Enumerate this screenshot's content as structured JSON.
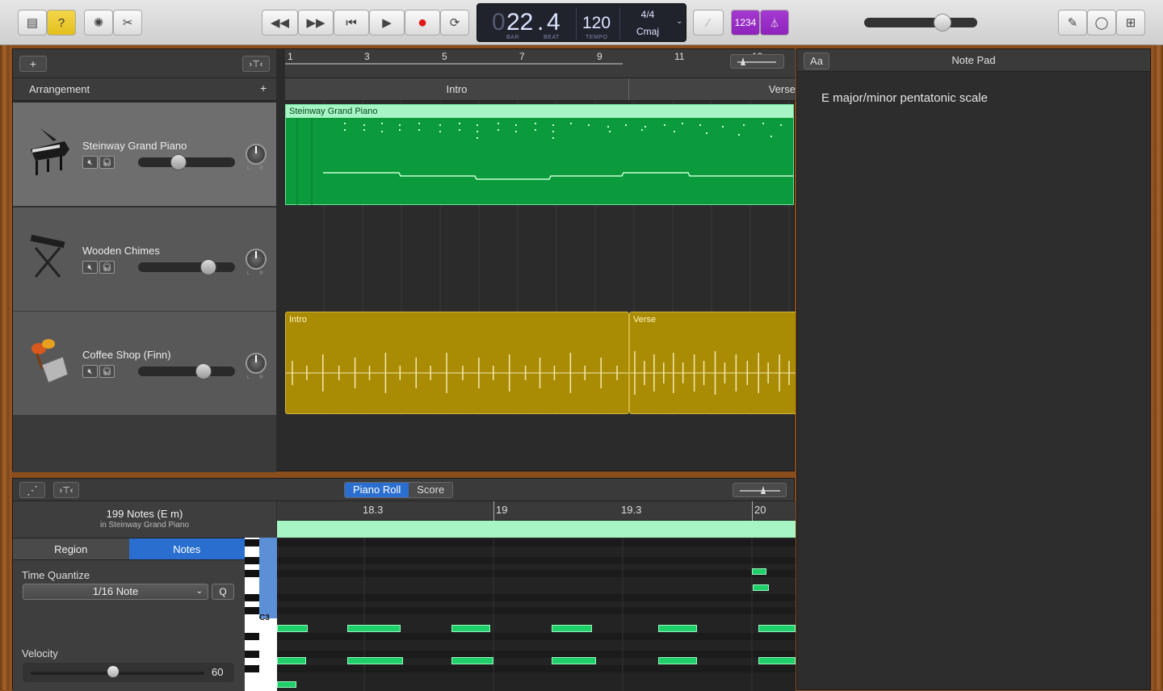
{
  "toolbar": {
    "lcd": {
      "bar": "22",
      "beat": "4",
      "bar_label": "BAR",
      "beat_label": "BEAT",
      "tempo": "120",
      "tempo_label": "TEMPO",
      "time_sig": "4/4",
      "key": "Cmaj"
    },
    "count_in_label": "1234",
    "help_icon": "question-icon",
    "accent_purple": "#9b2fc9",
    "accent_yellow": "#eac92a"
  },
  "tracks_panel": {
    "add_label": "+",
    "arrangement_label": "Arrangement",
    "arrangement_add": "+"
  },
  "tracks": [
    {
      "name": "Steinway Grand Piano",
      "volume": 0.42
    },
    {
      "name": "Wooden Chimes",
      "volume": 0.72
    },
    {
      "name": "Coffee Shop (Finn)",
      "volume": 0.67
    }
  ],
  "ruler": {
    "numbers": [
      "1",
      "3",
      "5",
      "7",
      "9",
      "11",
      "13"
    ]
  },
  "arrangement_markers": [
    {
      "label": "Intro"
    },
    {
      "label": "Verse"
    }
  ],
  "regions": {
    "piano": "Steinway Grand Piano",
    "intro": "Intro",
    "verse": "Verse"
  },
  "notepad": {
    "title": "Note Pad",
    "font_button": "Aa",
    "text": "E major/minor pentatonic scale"
  },
  "editor": {
    "tabs": [
      "Piano Roll",
      "Score"
    ],
    "active_tab": "Piano Roll",
    "note_count": "199 Notes (E m)",
    "note_source": "in Steinway Grand Piano",
    "inspector_tabs": [
      "Region",
      "Notes"
    ],
    "time_quantize_label": "Time Quantize",
    "quantize_value": "1/16 Note",
    "q_button": "Q",
    "velocity_label": "Velocity",
    "velocity_value": "60",
    "key_label": "C3",
    "ruler": [
      "18.3",
      "19",
      "19.3",
      "20"
    ]
  }
}
